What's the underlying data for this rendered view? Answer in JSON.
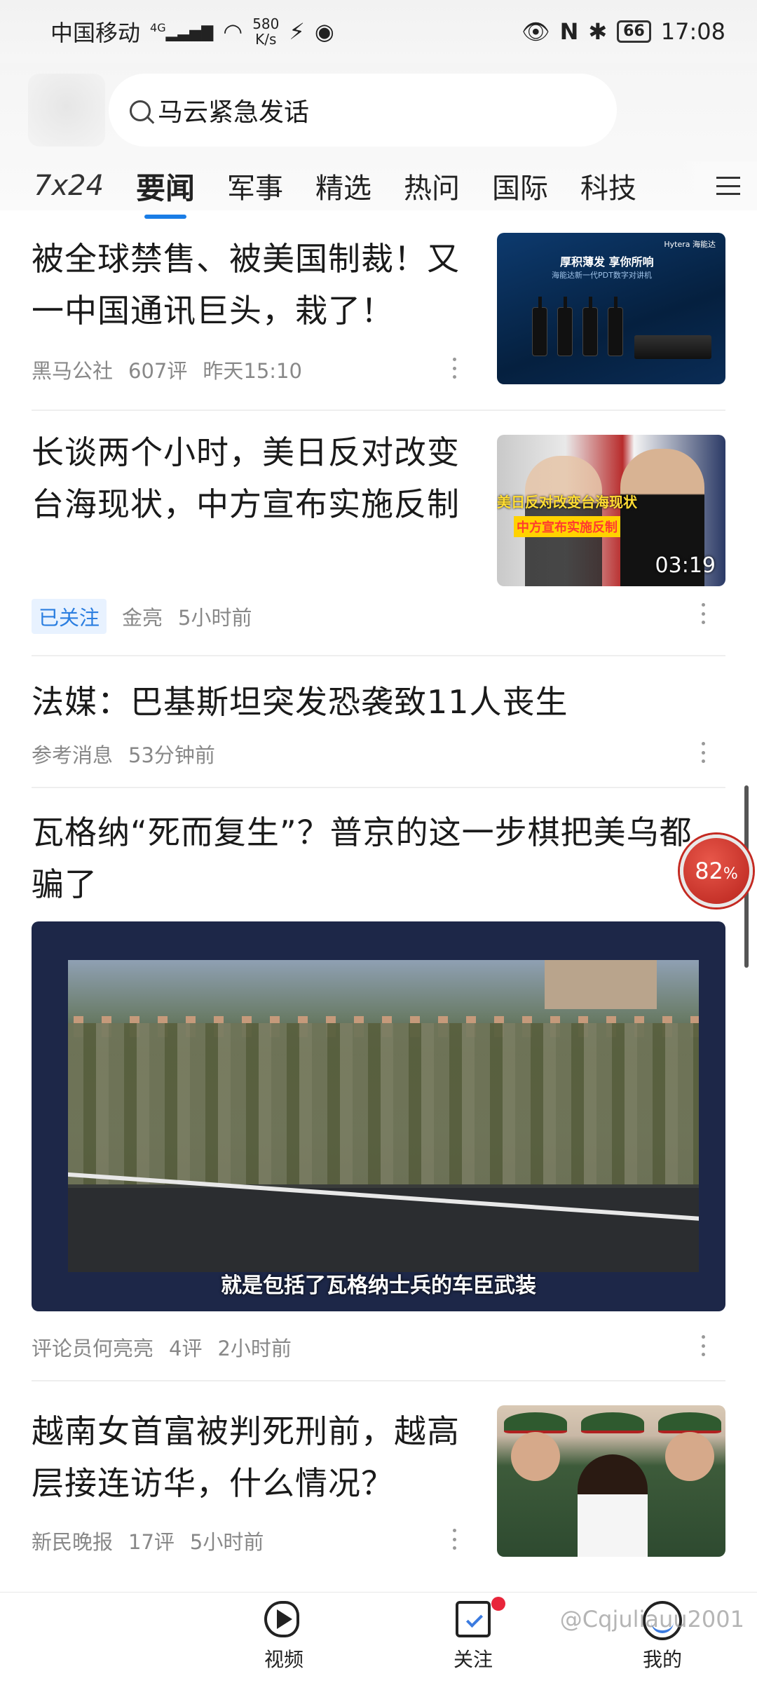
{
  "status_bar": {
    "carrier": "中国移动",
    "network": "4G",
    "net_speed_value": "580",
    "net_speed_unit": "K/s",
    "battery": "66",
    "time": "17:08"
  },
  "search": {
    "query": "马云紧急发话"
  },
  "tabs": [
    "7x24",
    "要闻",
    "军事",
    "精选",
    "热问",
    "国际",
    "科技"
  ],
  "active_tab": "要闻",
  "feed": [
    {
      "title": "被全球禁售、被美国制裁！又一中国通讯巨头，栽了！",
      "source": "黑马公社",
      "comments": "607评",
      "time": "昨天15:10",
      "thumb": {
        "headline": "厚积薄发 享你所响",
        "subline": "海能达新一代PDT数字对讲机",
        "brand": "Hytera 海能达"
      }
    },
    {
      "title": "长谈两个小时，美日反对改变台海现状，中方宣布实施反制",
      "tag": "已关注",
      "source": "金亮",
      "time": "5小时前",
      "thumb": {
        "caption1": "美日反对改变台海现状",
        "caption2": "中方宣布实施反制",
        "duration": "03:19"
      }
    },
    {
      "title": "法媒：巴基斯坦突发恐袭致11人丧生",
      "source": "参考消息",
      "time": "53分钟前"
    },
    {
      "title": "瓦格纳“死而复生”？普京的这一步棋把美乌都骗了",
      "subtitle_caption": "就是包括了瓦格纳士兵的车臣武装",
      "source": "评论员何亮亮",
      "comments": "4评",
      "time": "2小时前"
    },
    {
      "title": "越南女首富被判死刑前，越高层接连访华，什么情况？",
      "source": "新民晚报",
      "comments": "17评",
      "time": "5小时前"
    }
  ],
  "progress_badge": {
    "value": "82",
    "unit": "%"
  },
  "bottom_nav": {
    "video": "视频",
    "follow": "关注",
    "me": "我的"
  },
  "watermark": "@Cqjuliauu2001",
  "colors": {
    "accent": "#1a7de6",
    "followed_tag_bg": "#e8f2ff",
    "progress_red": "#c42a22"
  }
}
